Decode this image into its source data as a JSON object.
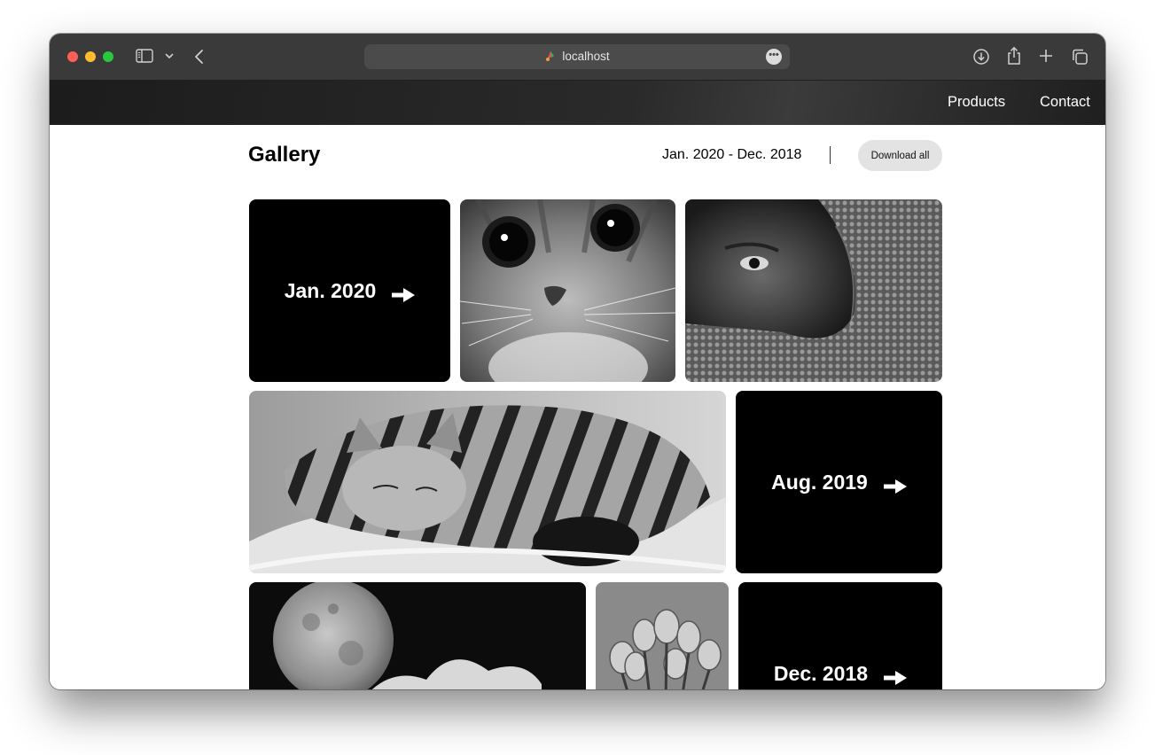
{
  "browser": {
    "url": "localhost",
    "icons": {
      "sidebar": "sidebar-icon",
      "chevron": "chevron-down-icon",
      "back": "back-arrow-icon",
      "more": "ellipsis-icon",
      "download": "download-icon",
      "share": "share-icon",
      "new_tab": "plus-icon",
      "tabs": "tab-overview-icon"
    }
  },
  "nav": {
    "products": "Products",
    "contact": "Contact"
  },
  "gallery": {
    "title": "Gallery",
    "date_range": "Jan. 2020 - Dec. 2018",
    "download_label": "Download all",
    "tiles": [
      {
        "type": "link",
        "label": "Jan. 2020"
      },
      {
        "type": "photo",
        "subject": "kitten-face"
      },
      {
        "type": "photo",
        "subject": "person-in-knit-hood"
      },
      {
        "type": "photo",
        "subject": "sleeping-tabby-cat"
      },
      {
        "type": "link",
        "label": "Aug. 2019"
      },
      {
        "type": "photo",
        "subject": "moon-and-clouds"
      },
      {
        "type": "photo",
        "subject": "tulips"
      },
      {
        "type": "link",
        "label": "Dec. 2018"
      }
    ]
  },
  "colors": {
    "titlebar": "#3a3a3a",
    "nav_bg": "#1c1c1c",
    "tile_black": "#000000",
    "button_bg": "#e3e3e3"
  }
}
